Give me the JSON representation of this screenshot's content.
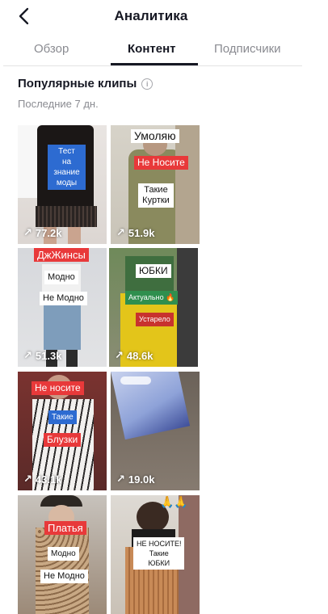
{
  "header": {
    "title": "Аналитика"
  },
  "tabs": [
    {
      "label": "Обзор",
      "active": false
    },
    {
      "label": "Контент",
      "active": true
    },
    {
      "label": "Подписчики",
      "active": false
    }
  ],
  "section": {
    "title": "Популярные клипы",
    "info_icon": "i",
    "period": "Последние 7 дн."
  },
  "clips": [
    {
      "views": "77.2k",
      "labels": [
        "Тест\nна знание\nмоды"
      ]
    },
    {
      "views": "51.9k",
      "labels": [
        "Умоляю",
        "Не Носите",
        "Такие\nКуртки"
      ]
    },
    {
      "views": "51.3k",
      "labels": [
        "ДжЖинсы",
        "Модно",
        "Не Модно"
      ]
    },
    {
      "views": "48.6k",
      "labels": [
        "ЮБКИ",
        "Актуально 🔥",
        "Устарело"
      ]
    },
    {
      "views": "43.1k",
      "labels": [
        "Не носите",
        "Такие",
        "Блузки"
      ]
    },
    {
      "views": "19.0k",
      "labels": []
    },
    {
      "views": "",
      "labels": [
        "Платья",
        "Модно",
        "Не Модно"
      ]
    },
    {
      "views": "",
      "labels": [
        "НЕ НОСИТЕ!\nТакие\nЮБКИ",
        "🙏🙏"
      ]
    }
  ],
  "colors": {
    "text": "#161823",
    "muted": "#8a8b91",
    "label_red": "#e8393a"
  }
}
